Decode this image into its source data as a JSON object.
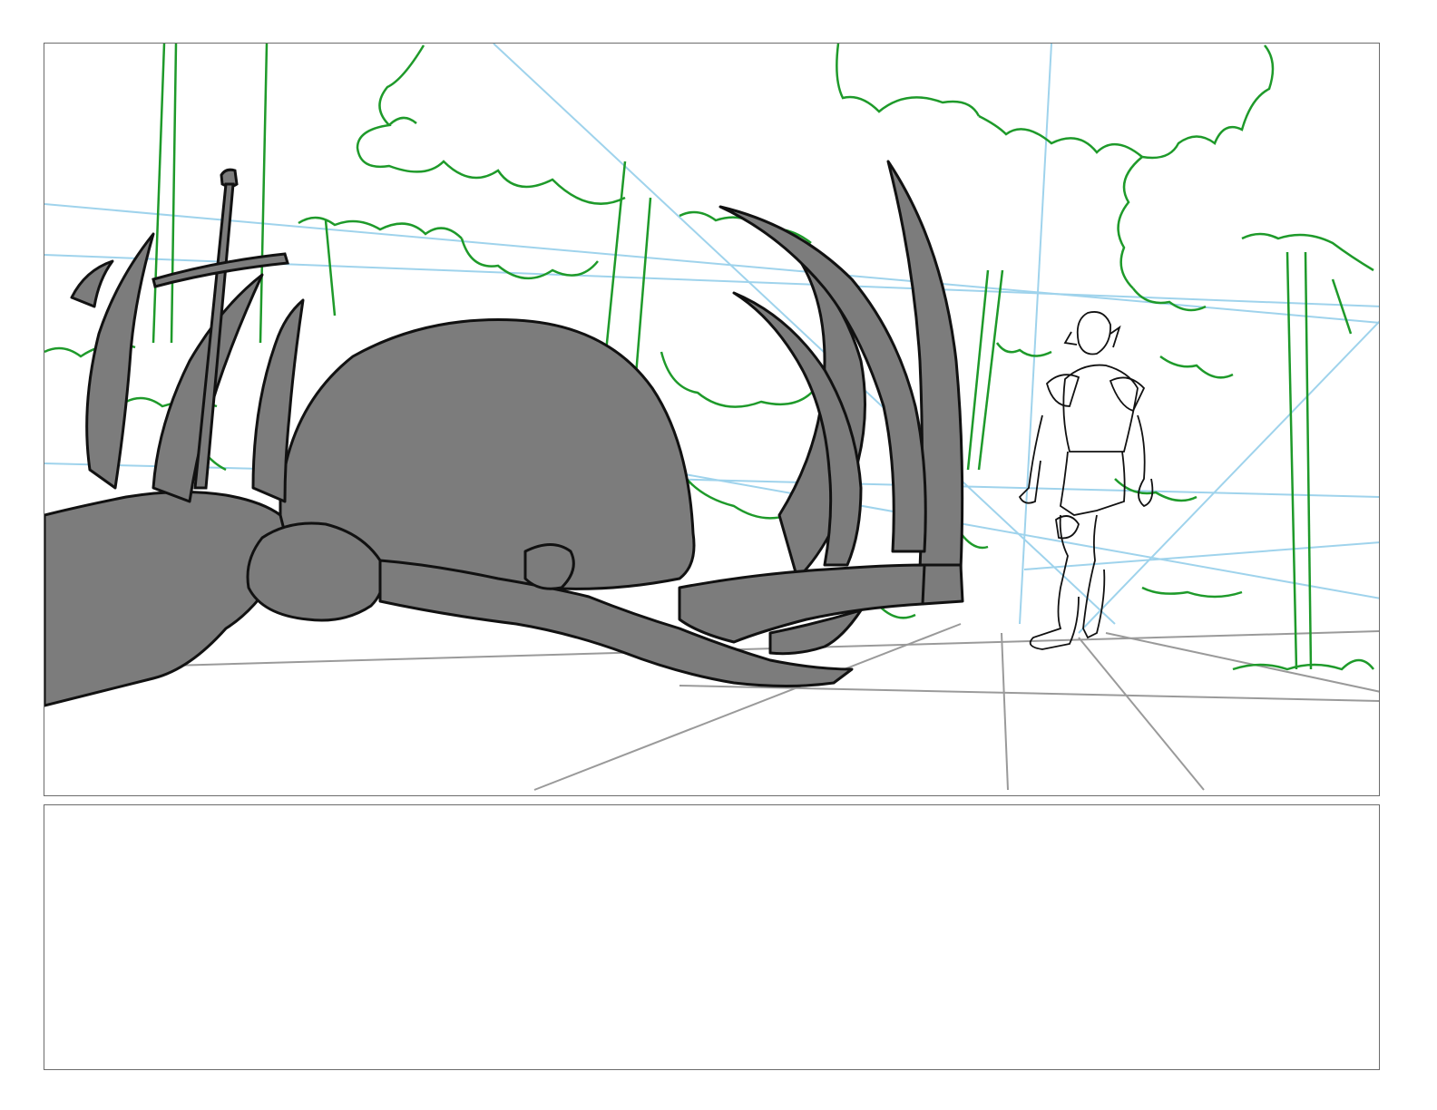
{
  "storyboard": {
    "panel": {
      "image": "monster-corpse-sketch",
      "colors": {
        "perspective": "#9fd3ec",
        "trees": "#1e9a2a",
        "floor": "#9a9a9a",
        "monster": "#7c7c7c",
        "ink": "#111111"
      }
    },
    "notes": {
      "text": ""
    }
  }
}
